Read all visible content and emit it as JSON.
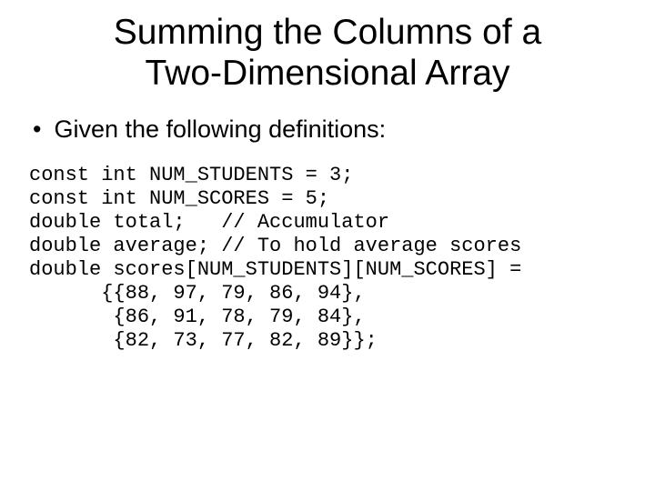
{
  "title_line1": "Summing the Columns of a",
  "title_line2": "Two-Dimensional Array",
  "bullet_dot": "•",
  "bullet_text": "Given the following definitions:",
  "code": {
    "l1": "const int NUM_STUDENTS = 3;",
    "l2": "const int NUM_SCORES = 5;",
    "l3": "double total;   // Accumulator",
    "l4": "double average; // To hold average scores",
    "l5": "double scores[NUM_STUDENTS][NUM_SCORES] =",
    "l6": "      {{88, 97, 79, 86, 94},",
    "l7": "       {86, 91, 78, 79, 84},",
    "l8": "       {82, 73, 77, 82, 89}};"
  }
}
